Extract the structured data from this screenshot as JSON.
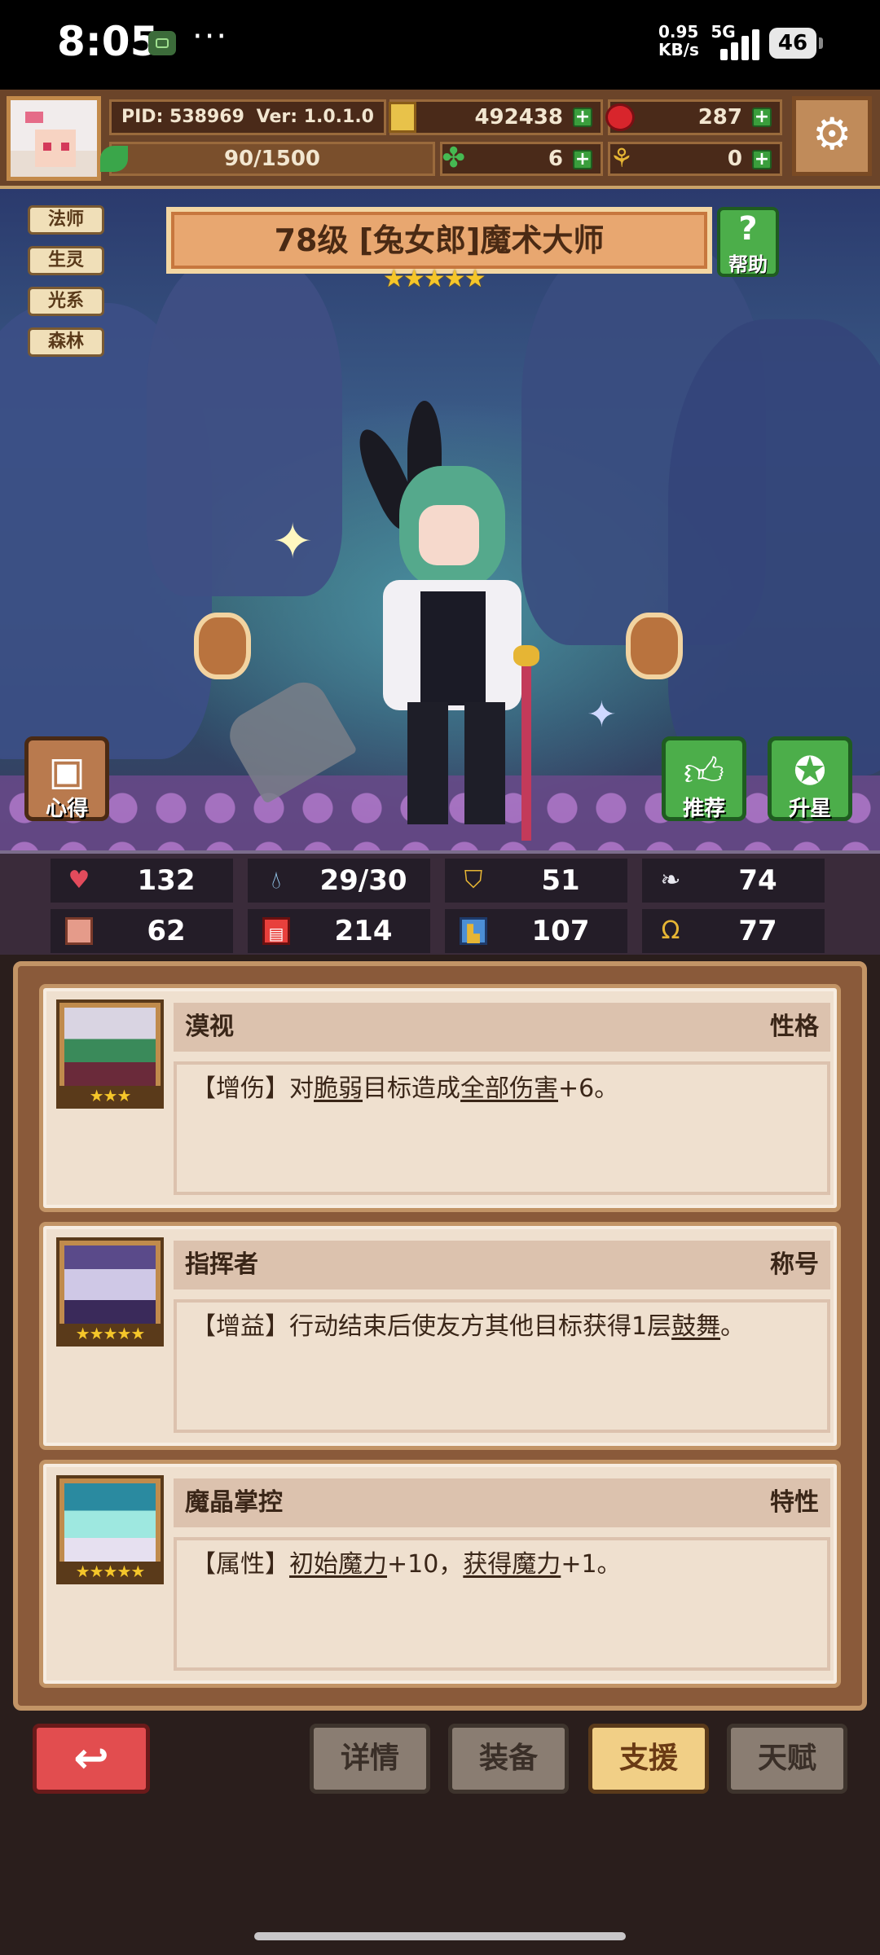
{
  "status_bar": {
    "time": "8:05",
    "net_speed": "0.95",
    "net_unit": "KB/s",
    "network": "5G",
    "battery": "46"
  },
  "header": {
    "pid": "PID: 538969",
    "version": "Ver: 1.0.1.0",
    "gold": "492438",
    "gems": "287",
    "stamina": "90/1500",
    "clover": "6",
    "horn": "0"
  },
  "hero": {
    "title": "78级 [兔女郎]魔术大师",
    "stars": "★★★★★",
    "tags": [
      "法师",
      "生灵",
      "光系",
      "森林"
    ],
    "help_label": "帮助",
    "xinde_label": "心得",
    "recommend_label": "推荐",
    "star_up_label": "升星"
  },
  "stats": [
    {
      "icon": "heart-icon",
      "value": "132"
    },
    {
      "icon": "mana-drop-icon",
      "value": "29/30"
    },
    {
      "icon": "shield-icon",
      "value": "51"
    },
    {
      "icon": "wing-icon",
      "value": "74"
    },
    {
      "icon": "fist-icon",
      "value": "62"
    },
    {
      "icon": "spellbook-icon",
      "value": "214"
    },
    {
      "icon": "boot-icon",
      "value": "107"
    },
    {
      "icon": "horseshoe-icon",
      "value": "77"
    }
  ],
  "cards": [
    {
      "name": "漠视",
      "category": "性格",
      "stars": "★★★",
      "desc_parts": [
        "【增伤】对",
        "脆弱",
        "目标造成",
        "全部伤害",
        "+6。"
      ]
    },
    {
      "name": "指挥者",
      "category": "称号",
      "stars": "★★★★★",
      "desc_parts": [
        "【增益】行动结束后使友方其他目标获得1层",
        "鼓舞",
        "。"
      ]
    },
    {
      "name": "魔晶掌控",
      "category": "特性",
      "stars": "★★★★★",
      "desc_parts": [
        "【属性】",
        "初始魔力",
        "+10，",
        "获得魔力",
        "+1。"
      ]
    }
  ],
  "bottom_tabs": {
    "details": "详情",
    "equipment": "装备",
    "support": "支援",
    "talent": "天赋"
  },
  "colors": {
    "panel_brown": "#8a5a3a",
    "active_tab": "#f1cf86",
    "back_red": "#e24d4f",
    "star_gold": "#f5c62a"
  }
}
